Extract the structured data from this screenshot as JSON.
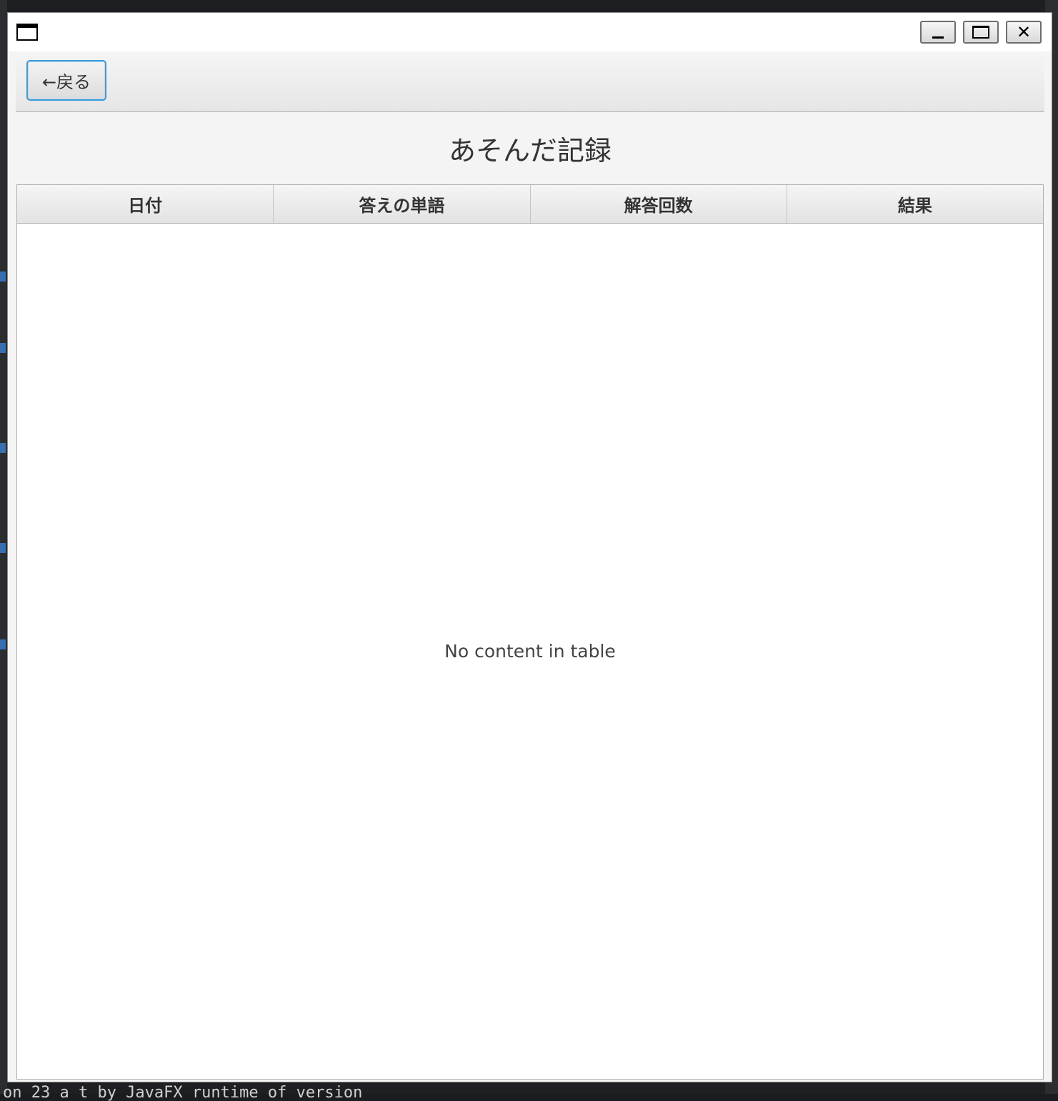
{
  "window": {
    "title": "",
    "controls": {
      "minimize_icon": "minimize-icon",
      "maximize_icon": "maximize-icon",
      "close_icon": "close-icon"
    }
  },
  "toolbar": {
    "back_label": "←戻る"
  },
  "page": {
    "title": "あそんだ記録"
  },
  "table": {
    "columns": [
      "日付",
      "答えの単語",
      "解答回数",
      "結果"
    ],
    "rows": [],
    "placeholder": "No content in table"
  },
  "background": {
    "bottom_text": "on 23 a t by JavaFX runtime of version"
  },
  "colors": {
    "focus_border": "#3b9ad9",
    "window_bg": "#f4f4f4",
    "table_bg": "#ffffff"
  }
}
